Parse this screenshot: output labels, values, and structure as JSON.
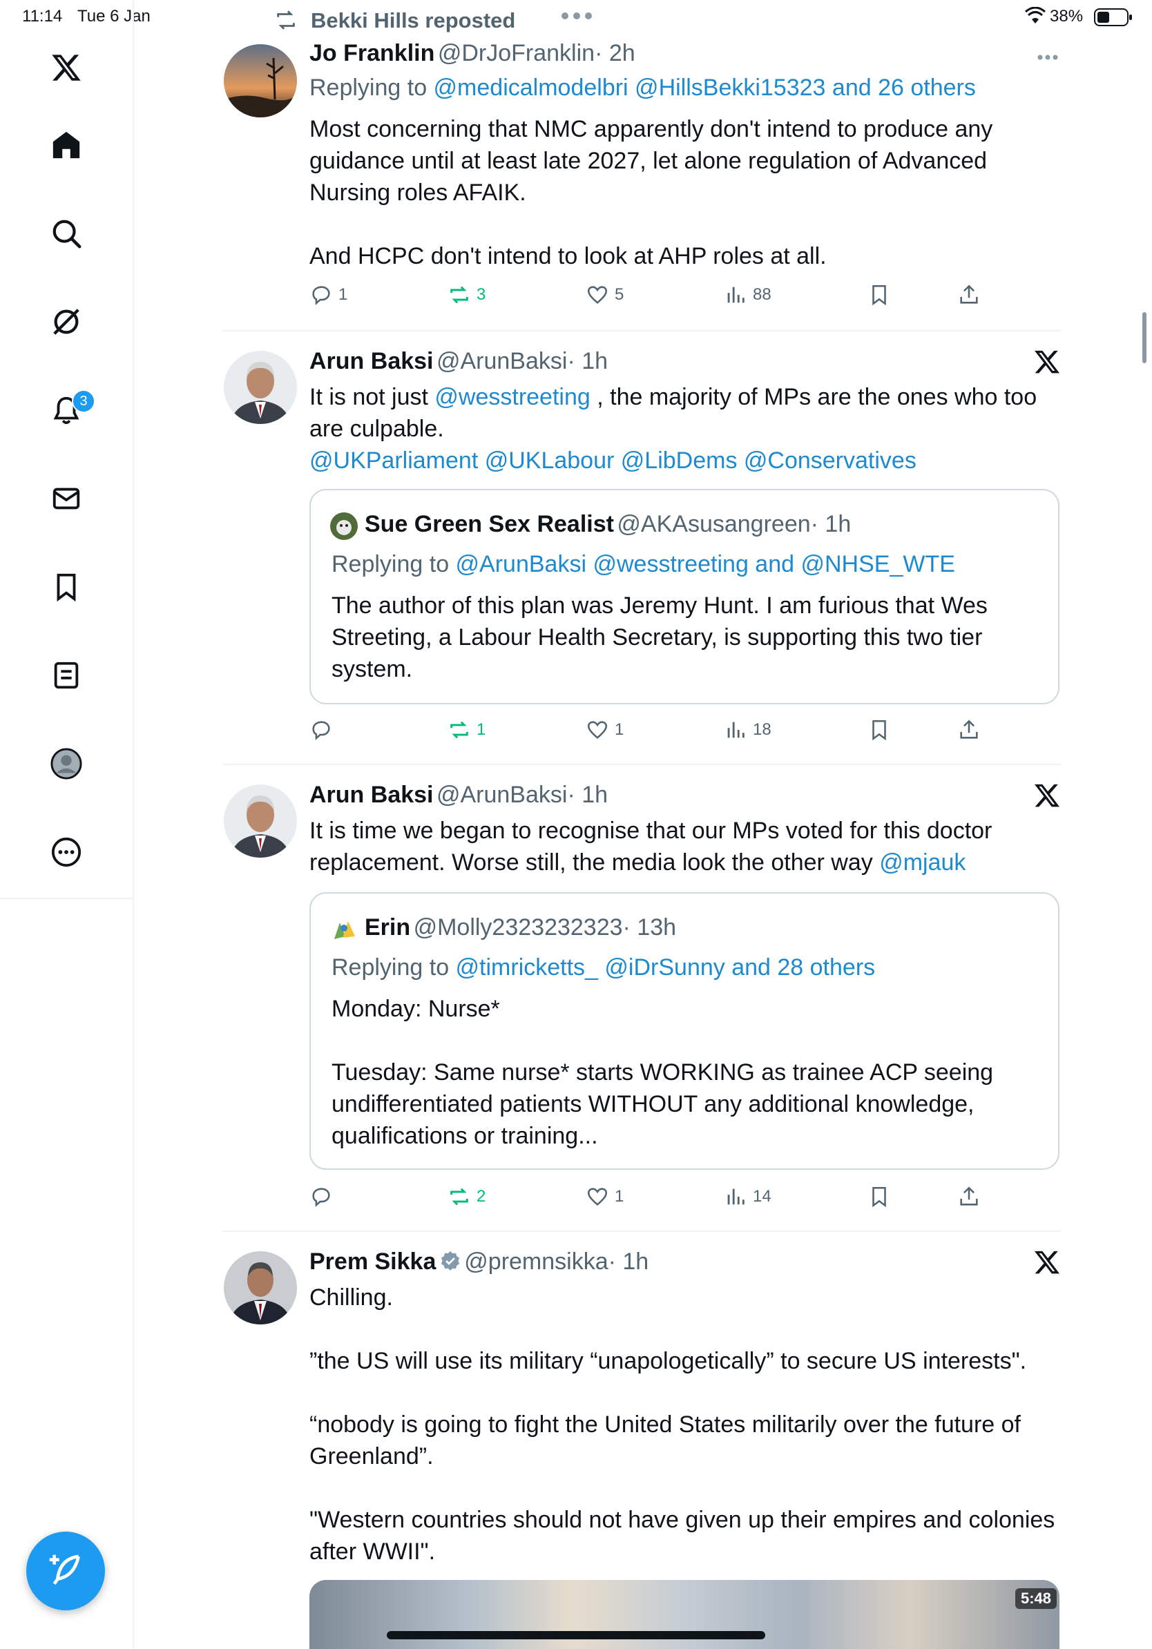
{
  "status_bar": {
    "time": "11:14",
    "date": "Tue 6 Jan",
    "battery": "38%"
  },
  "repost_banner": {
    "text": "Bekki Hills reposted"
  },
  "nav": {
    "items": [
      {
        "icon": "x-logo-icon"
      },
      {
        "icon": "home-icon"
      },
      {
        "icon": "search-icon"
      },
      {
        "icon": "grok-icon"
      },
      {
        "icon": "notifications-icon",
        "badge": "3"
      },
      {
        "icon": "messages-icon"
      },
      {
        "icon": "bookmarks-icon"
      },
      {
        "icon": "lists-icon"
      },
      {
        "icon": "profile-icon"
      },
      {
        "icon": "more-icon"
      }
    ],
    "compose_icon": "compose-icon"
  },
  "tweets": [
    {
      "name": "Jo Franklin",
      "handle": "@DrJoFranklin",
      "time": "· 2h",
      "replying_prefix": "Replying to ",
      "replying_to": "@medicalmodelbri @HillsBekki15323 and 26 others",
      "body": [
        "Most concerning that NMC apparently don't intend to produce any",
        "guidance until at least late 2027, let alone regulation of Advanced",
        "Nursing roles AFAIK.",
        "",
        "And HCPC don't intend to look at AHP roles at all."
      ],
      "stats": {
        "replies": "1",
        "reposts": "3",
        "likes": "5",
        "views": "88"
      }
    },
    {
      "name": "Arun Baksi",
      "handle": "@ArunBaksi",
      "time": "· 1h",
      "body_line1_pre": "It is not just ",
      "body_line1_link": "@wesstreeting",
      "body_line1_post": " , the majority of MPs are the ones who too",
      "body_line2": "are culpable.",
      "body_line3": "@UKParliament @UKLabour @LibDems @Conservatives",
      "quote": {
        "name": "Sue Green Sex Realist",
        "handle": "@AKAsusangreen",
        "time": "· 1h",
        "replying_prefix": "Replying to ",
        "replying_to": "@ArunBaksi @wesstreeting and @NHSE_WTE",
        "body": [
          "The author of this plan was Jeremy Hunt. I am furious that Wes",
          "Streeting, a Labour Health Secretary, is supporting this two tier",
          "system."
        ]
      },
      "stats": {
        "replies": "",
        "reposts": "1",
        "likes": "1",
        "views": "18"
      }
    },
    {
      "name": "Arun Baksi",
      "handle": "@ArunBaksi",
      "time": "· 1h",
      "body_line1": "It is time we began to recognise that our MPs voted for this doctor",
      "body_line2_pre": "replacement. Worse still, the media look the other way ",
      "body_line2_link": "@mjauk",
      "quote": {
        "name": "Erin",
        "handle": "@Molly2323232323",
        "time": "· 13h",
        "replying_prefix": "Replying to ",
        "replying_to": "@timricketts_ @iDrSunny and 28 others",
        "body": [
          "Monday: Nurse*",
          "",
          "Tuesday: Same nurse* starts WORKING as trainee ACP seeing",
          "undifferentiated patients  WITHOUT any additional knowledge,",
          "qualifications or training..."
        ]
      },
      "stats": {
        "replies": "",
        "reposts": "2",
        "likes": "1",
        "views": "14"
      }
    },
    {
      "name": "Prem Sikka",
      "handle": "@premnsikka",
      "time": "· 1h",
      "body": [
        "Chilling.",
        "",
        "”the US will use its military “unapologetically” to secure US interests\".",
        "",
        "“nobody is going to fight the United States militarily over the future of",
        "Greenland”.",
        "",
        "\"Western countries should not have given up their empires and colonies",
        "after WWII\"."
      ],
      "video_duration": "5:48"
    }
  ]
}
